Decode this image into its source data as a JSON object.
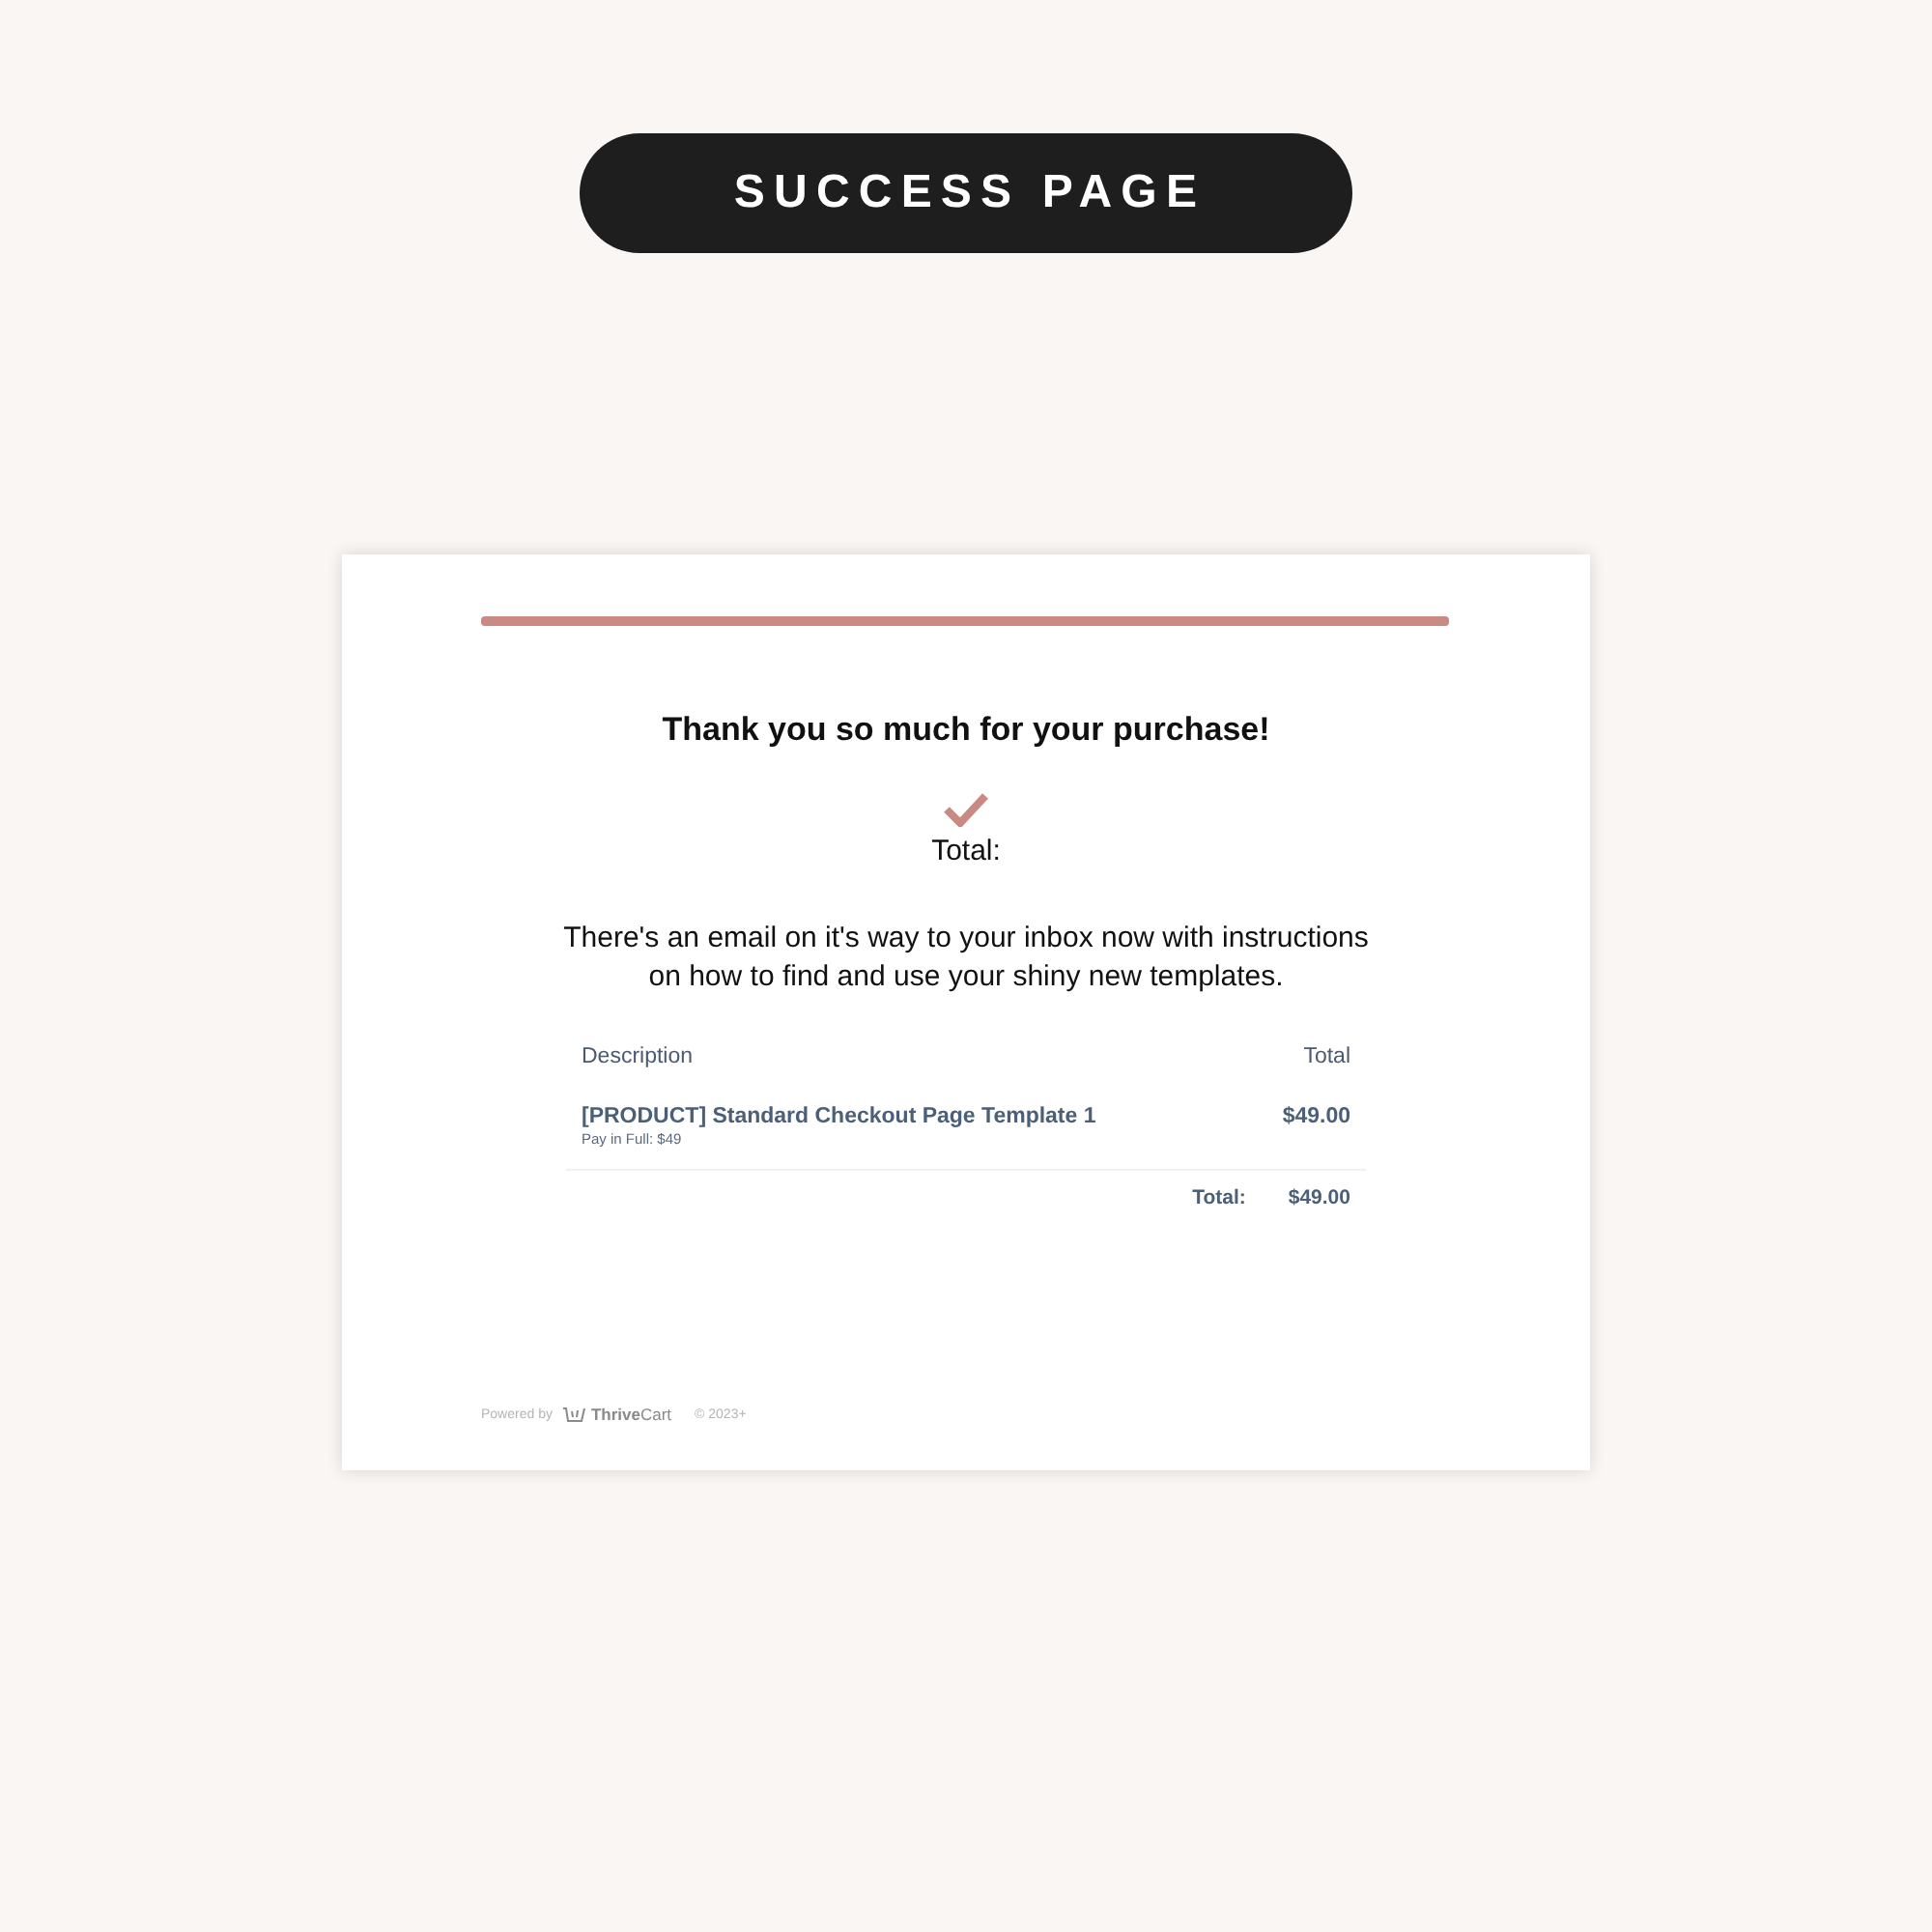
{
  "badge": {
    "label": "SUCCESS PAGE"
  },
  "confirmation": {
    "heading": "Thank you so much for your purchase!",
    "total_label": "Total:",
    "message": "There's an email on it's way to your inbox now with instructions on how to find and use your shiny new templates."
  },
  "order_table": {
    "columns": [
      "Description",
      "Total"
    ],
    "rows": [
      {
        "description": "[PRODUCT] Standard Checkout Page Template 1",
        "note": "Pay in Full: $49",
        "total": "$49.00"
      }
    ],
    "summary": {
      "label": "Total:",
      "value": "$49.00"
    }
  },
  "footer": {
    "powered_by": "Powered by",
    "brand": "**Thrive**Cart",
    "copyright": "© 2023+"
  }
}
